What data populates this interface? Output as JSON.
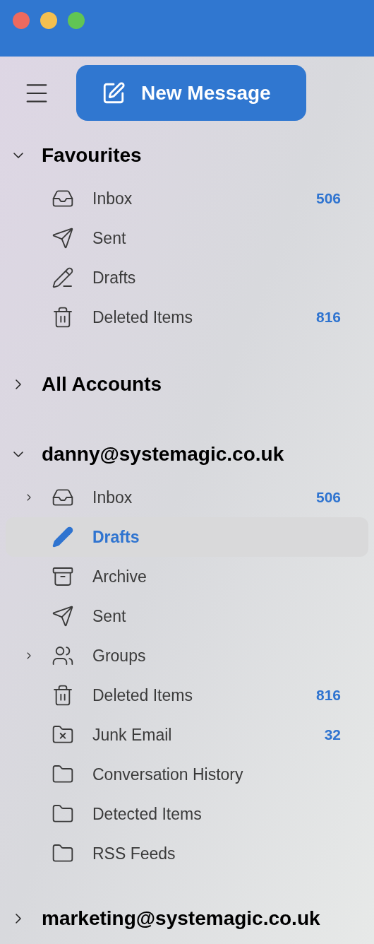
{
  "new_message_button": {
    "label": "New Message"
  },
  "sections": [
    {
      "title": "Favourites",
      "expanded": true,
      "items": [
        {
          "kind": "inbox",
          "label": "Inbox",
          "count": "506",
          "selected": false
        },
        {
          "kind": "sent",
          "label": "Sent",
          "selected": false
        },
        {
          "kind": "drafts",
          "label": "Drafts",
          "selected": false
        },
        {
          "kind": "trash",
          "label": "Deleted Items",
          "count": "816",
          "selected": false
        }
      ]
    },
    {
      "title": "All Accounts",
      "expanded": false
    },
    {
      "title": "danny@systemagic.co.uk",
      "expanded": true,
      "items": [
        {
          "kind": "inbox",
          "label": "Inbox",
          "count": "506",
          "selected": false,
          "expanded": false
        },
        {
          "kind": "drafts",
          "label": "Drafts",
          "selected": true
        },
        {
          "kind": "archive",
          "label": "Archive",
          "selected": false
        },
        {
          "kind": "sent",
          "label": "Sent",
          "selected": false
        },
        {
          "kind": "groups",
          "label": "Groups",
          "selected": false,
          "expanded": false
        },
        {
          "kind": "trash",
          "label": "Deleted Items",
          "count": "816",
          "selected": false
        },
        {
          "kind": "junk",
          "label": "Junk Email",
          "count": "32",
          "selected": false
        },
        {
          "kind": "folder",
          "label": "Conversation History",
          "selected": false
        },
        {
          "kind": "folder",
          "label": "Detected Items",
          "selected": false
        },
        {
          "kind": "folder",
          "label": "RSS Feeds",
          "selected": false
        }
      ]
    },
    {
      "title": "marketing@systemagic.co.uk",
      "expanded": false
    }
  ]
}
